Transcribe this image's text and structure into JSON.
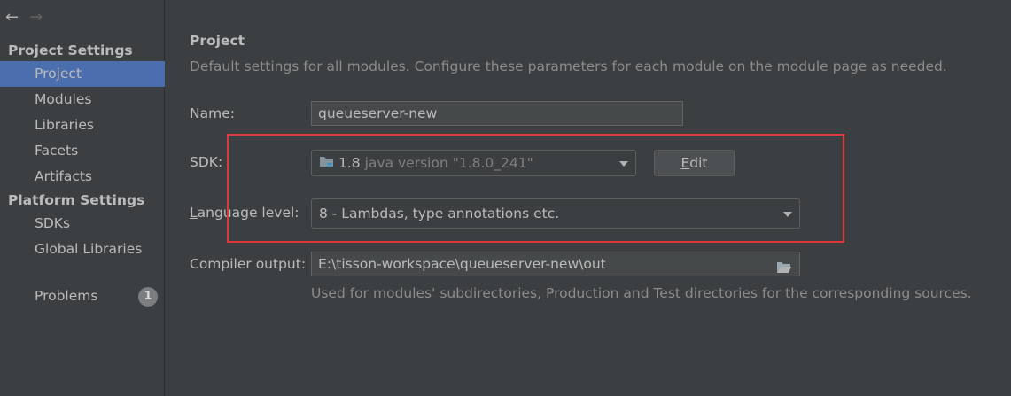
{
  "nav": {
    "back": "←",
    "forward": "→"
  },
  "sidebar": {
    "project_settings_header": "Project Settings",
    "project_settings_items": [
      {
        "label": "Project",
        "selected": true
      },
      {
        "label": "Modules"
      },
      {
        "label": "Libraries"
      },
      {
        "label": "Facets"
      },
      {
        "label": "Artifacts"
      }
    ],
    "platform_settings_header": "Platform Settings",
    "platform_settings_items": [
      {
        "label": "SDKs"
      },
      {
        "label": "Global Libraries"
      }
    ],
    "problems": {
      "label": "Problems",
      "count": "1"
    }
  },
  "main": {
    "title": "Project",
    "description": "Default settings for all modules. Configure these parameters for each module on the module page as needed.",
    "name": {
      "label": "Name:",
      "value": "queueserver-new"
    },
    "sdk": {
      "label": "SDK:",
      "version": "1.8",
      "detail": "java version \"1.8.0_241\"",
      "edit_button": "Edit"
    },
    "language_level": {
      "label": "Language level:",
      "value": "8 - Lambdas, type annotations etc."
    },
    "compiler_output": {
      "label": "Compiler output:",
      "value": "E:\\tisson-workspace\\queueserver-new\\out",
      "hint": "Used for modules' subdirectories, Production and Test directories for the corresponding sources."
    }
  },
  "colors": {
    "background": "#3c3f41",
    "selection": "#4b6eaf",
    "highlight_box": "#e0383b",
    "text": "#bbbbbb",
    "muted_text": "#8c8c8c"
  }
}
